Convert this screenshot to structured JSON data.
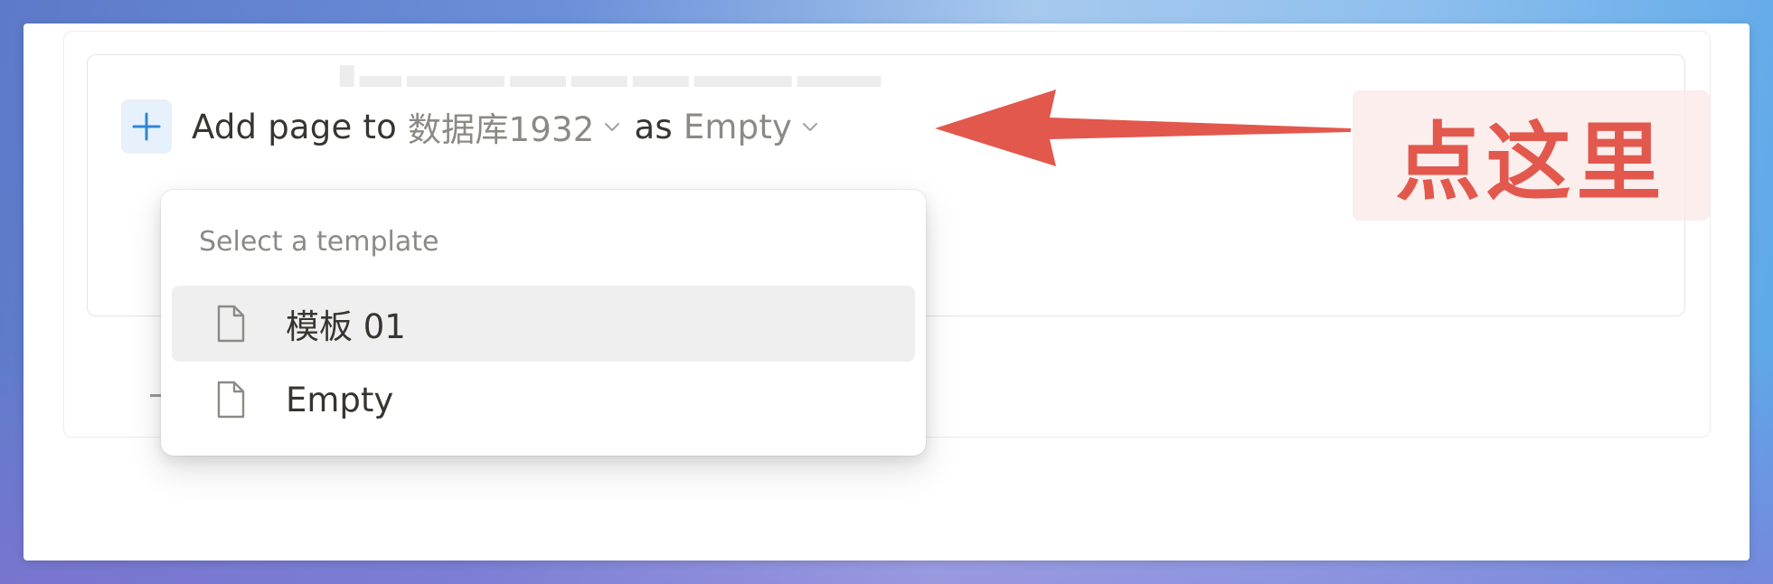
{
  "toolbar": {
    "add_page_label": "Add page to",
    "database_name": "数据库1932",
    "as_label": "as",
    "template_value": "Empty"
  },
  "annotation": {
    "text": "点这里"
  },
  "dropdown": {
    "header": "Select a template",
    "items": [
      {
        "label": "模板 01",
        "icon": "page-icon",
        "highlighted": true
      },
      {
        "label": "Empty",
        "icon": "page-icon",
        "highlighted": false
      }
    ]
  },
  "colors": {
    "accent_blue": "#2f86d6",
    "annotation_red": "#e2584d",
    "text_primary": "#373530",
    "text_muted": "#8b8a86"
  }
}
